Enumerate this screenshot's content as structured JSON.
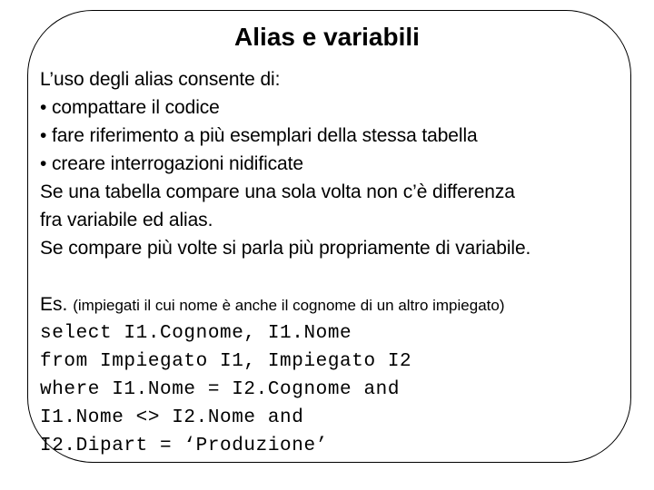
{
  "slide": {
    "title": "Alias e variabili",
    "border_color": "#000000",
    "background_color": "#ffffff",
    "text_color": "#000000",
    "body_lines": [
      "L’uso degli alias consente di:",
      "• compattare il codice",
      "• fare riferimento a più esemplari della stessa tabella",
      "• creare interrogazioni nidificate",
      "Se una tabella compare una sola volta non c’è differenza",
      "fra variabile ed alias.",
      "Se compare più volte si parla più propriamente di variabile."
    ],
    "example": {
      "label": "Es.",
      "note": "(impiegati il cui nome è anche il cognome di un altro impiegato)"
    },
    "code_lines": [
      "select I1.Cognome, I1.Nome",
      "from Impiegato I1, Impiegato I2",
      "where I1.Nome = I2.Cognome and",
      "I1.Nome <> I2.Nome and",
      "I2.Dipart = ‘Produzione’"
    ]
  }
}
